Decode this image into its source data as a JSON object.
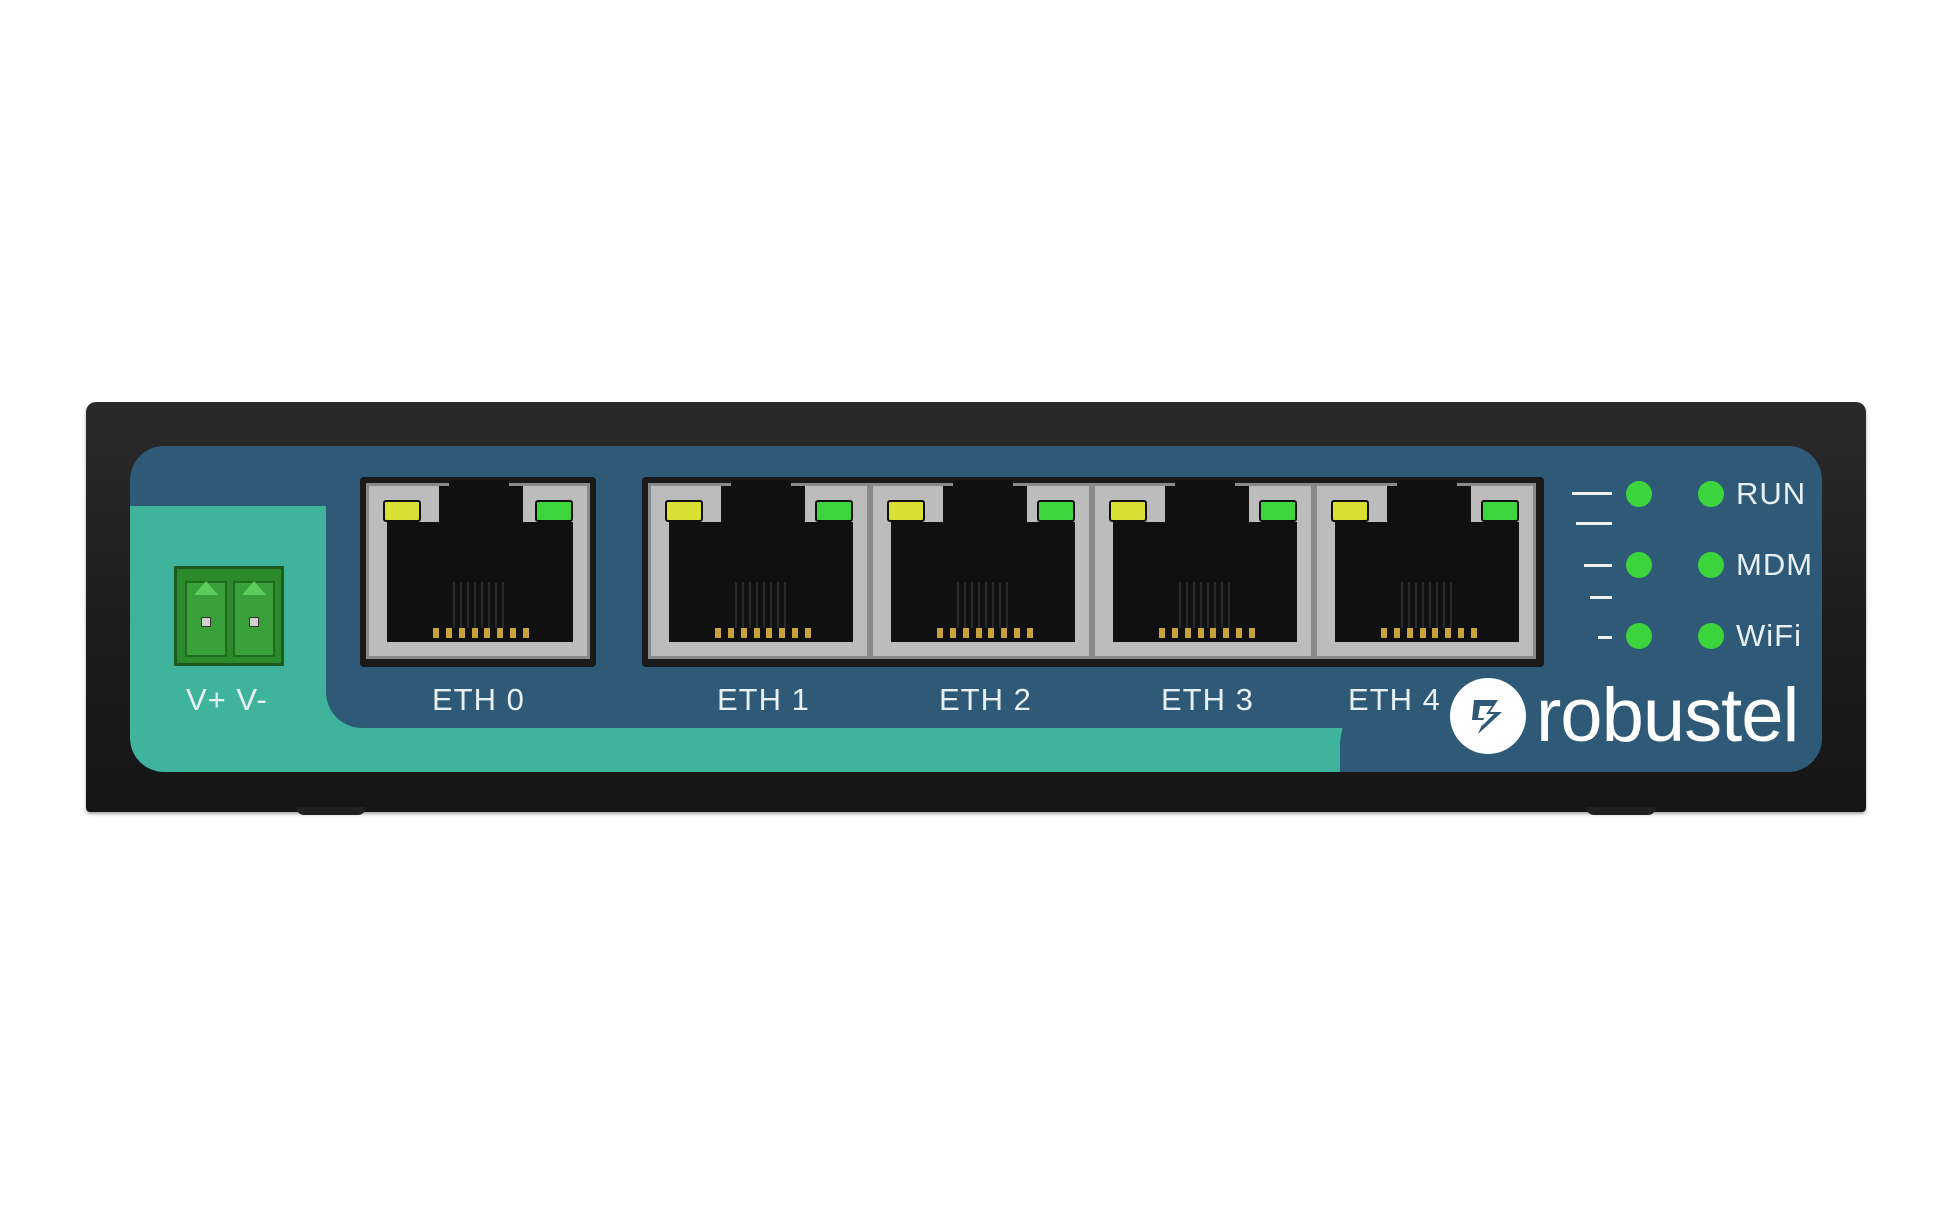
{
  "device": {
    "brand": "robustel",
    "power_label": "V+ V-",
    "ports": [
      {
        "label": "ETH 0"
      },
      {
        "label": "ETH 1"
      },
      {
        "label": "ETH 2"
      },
      {
        "label": "ETH 3"
      },
      {
        "label": "ETH 4"
      }
    ],
    "status_leds": [
      {
        "label": "RUN"
      },
      {
        "label": "MDM"
      },
      {
        "label": "WiFi"
      }
    ]
  },
  "colors": {
    "body": "#1b1b1b",
    "faceplate": "#2e5a78",
    "accent_teal": "#3fb39c",
    "led_green": "#3dd43d",
    "led_yellow": "#d8e034",
    "connector_green": "#2c8a2c"
  },
  "icons": {
    "logo": "robustel-logo-icon",
    "power_connector": "terminal-block-icon",
    "port": "rj45-port-icon"
  }
}
